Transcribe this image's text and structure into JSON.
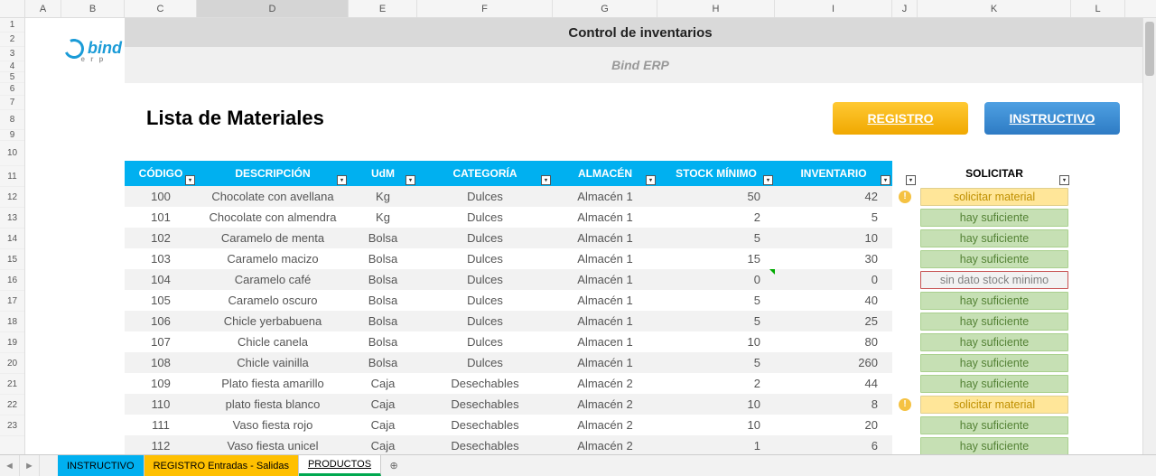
{
  "columns": [
    "A",
    "B",
    "C",
    "D",
    "E",
    "F",
    "G",
    "H",
    "I",
    "J",
    "K",
    "L"
  ],
  "activeColumn": "D",
  "rowNumbers": [
    1,
    2,
    3,
    4,
    5,
    6,
    7,
    8,
    9,
    10,
    11,
    12,
    13,
    14,
    15,
    16,
    17,
    18,
    19,
    20,
    21,
    22,
    23
  ],
  "banner": {
    "title": "Control de inventarios",
    "subtitle": "Bind ERP"
  },
  "logo": {
    "text": "bind",
    "sub": "e r p"
  },
  "page": {
    "title": "Lista de Materiales",
    "btnRegistro": "REGISTRO",
    "btnInstructivo": "INSTRUCTIVO"
  },
  "headers": {
    "codigo": "CÓDIGO",
    "descripcion": "DESCRIPCIÓN",
    "udm": "UdM",
    "categoria": "CATEGORÍA",
    "almacen": "ALMACÉN",
    "stockmin": "STOCK MÍNIMO",
    "inventario": "INVENTARIO",
    "solicitar": "SOLICITAR"
  },
  "statusLabels": {
    "solicitar": "solicitar material",
    "suficiente": "hay suficiente",
    "sindato": "sin dato stock minimo"
  },
  "rows": [
    {
      "codigo": "100",
      "desc": "Chocolate con avellana",
      "udm": "Kg",
      "cat": "Dulces",
      "alm": "Almacén 1",
      "min": "50",
      "inv": "42",
      "status": "solicitar",
      "alert": true
    },
    {
      "codigo": "101",
      "desc": "Chocolate con almendra",
      "udm": "Kg",
      "cat": "Dulces",
      "alm": "Almacén 1",
      "min": "2",
      "inv": "5",
      "status": "suficiente",
      "alert": false
    },
    {
      "codigo": "102",
      "desc": "Caramelo de menta",
      "udm": "Bolsa",
      "cat": "Dulces",
      "alm": "Almacén 1",
      "min": "5",
      "inv": "10",
      "status": "suficiente",
      "alert": false
    },
    {
      "codigo": "103",
      "desc": "Caramelo macizo",
      "udm": "Bolsa",
      "cat": "Dulces",
      "alm": "Almacén 1",
      "min": "15",
      "inv": "30",
      "status": "suficiente",
      "alert": false
    },
    {
      "codigo": "104",
      "desc": "Caramelo café",
      "udm": "Bolsa",
      "cat": "Dulces",
      "alm": "Almacén 1",
      "min": "0",
      "inv": "0",
      "status": "sindato",
      "alert": false,
      "greenTri": true
    },
    {
      "codigo": "105",
      "desc": "Caramelo oscuro",
      "udm": "Bolsa",
      "cat": "Dulces",
      "alm": "Almacén 1",
      "min": "5",
      "inv": "40",
      "status": "suficiente",
      "alert": false
    },
    {
      "codigo": "106",
      "desc": "Chicle yerbabuena",
      "udm": "Bolsa",
      "cat": "Dulces",
      "alm": "Almacén 1",
      "min": "5",
      "inv": "25",
      "status": "suficiente",
      "alert": false
    },
    {
      "codigo": "107",
      "desc": "Chicle canela",
      "udm": "Bolsa",
      "cat": "Dulces",
      "alm": "Almacen 1",
      "min": "10",
      "inv": "80",
      "status": "suficiente",
      "alert": false
    },
    {
      "codigo": "108",
      "desc": "Chicle vainilla",
      "udm": "Bolsa",
      "cat": "Dulces",
      "alm": "Almacén 1",
      "min": "5",
      "inv": "260",
      "status": "suficiente",
      "alert": false
    },
    {
      "codigo": "109",
      "desc": "Plato fiesta amarillo",
      "udm": "Caja",
      "cat": "Desechables",
      "alm": "Almacén 2",
      "min": "2",
      "inv": "44",
      "status": "suficiente",
      "alert": false
    },
    {
      "codigo": "110",
      "desc": "plato fiesta blanco",
      "udm": "Caja",
      "cat": "Desechables",
      "alm": "Almacén 2",
      "min": "10",
      "inv": "8",
      "status": "solicitar",
      "alert": true
    },
    {
      "codigo": "111",
      "desc": "Vaso fiesta rojo",
      "udm": "Caja",
      "cat": "Desechables",
      "alm": "Almacén 2",
      "min": "10",
      "inv": "20",
      "status": "suficiente",
      "alert": false
    },
    {
      "codigo": "112",
      "desc": "Vaso fiesta unicel",
      "udm": "Caja",
      "cat": "Desechables",
      "alm": "Almacén 2",
      "min": "1",
      "inv": "6",
      "status": "suficiente",
      "alert": false
    }
  ],
  "tabs": {
    "instructivo": "INSTRUCTIVO",
    "registro": "REGISTRO Entradas - Salidas",
    "productos": "PRODUCTOS"
  },
  "icons": {
    "filterGlyph": "▾",
    "addTab": "⊕",
    "scrollLeft": "◄",
    "scrollRight": "►",
    "alert": "!"
  }
}
